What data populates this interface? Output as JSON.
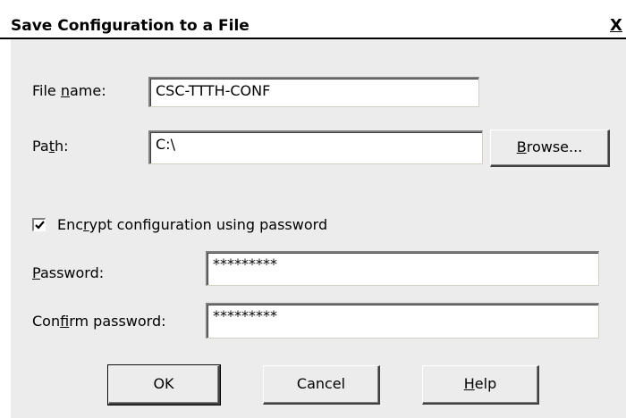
{
  "dialog": {
    "title": "Save Configuration to a File",
    "close_glyph": "X"
  },
  "fields": {
    "file_name": {
      "label_pre": "File ",
      "label_accel": "n",
      "label_post": "ame:",
      "value": "CSC-TTTH-CONF"
    },
    "path": {
      "label_pre": "Pa",
      "label_accel": "t",
      "label_post": "h:",
      "value": "C:\\"
    },
    "password": {
      "label_pre": "",
      "label_accel": "P",
      "label_post": "assword:",
      "value": "*********"
    },
    "confirm_password": {
      "label_pre": "Con",
      "label_accel": "f",
      "label_post": "irm password:",
      "value": "*********"
    }
  },
  "encrypt": {
    "checked": true,
    "label_pre": "Enc",
    "label_accel": "r",
    "label_post": "ypt configuration using password"
  },
  "buttons": {
    "browse": {
      "pre": "",
      "accel": "B",
      "post": "rowse..."
    },
    "ok": {
      "label": "OK"
    },
    "cancel": {
      "label": "Cancel"
    },
    "help": {
      "pre": "",
      "accel": "H",
      "post": "elp"
    }
  }
}
